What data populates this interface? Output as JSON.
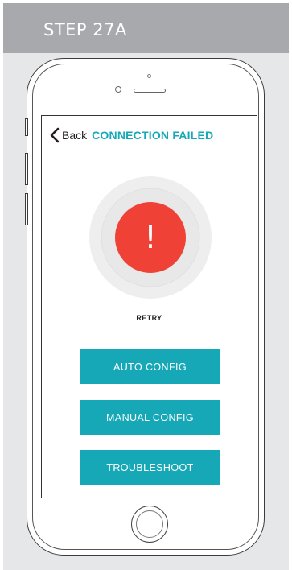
{
  "header": {
    "step_label": "STEP 27A"
  },
  "nav": {
    "back_label": "Back",
    "title": "CONNECTION FAILED"
  },
  "status": {
    "alert_symbol": "!",
    "retry_label": "RETRY"
  },
  "actions": {
    "auto_config": "AUTO CONFIG",
    "manual_config": "MANUAL CONFIG",
    "troubleshoot": "TROUBLESHOOT"
  },
  "colors": {
    "accent": "#17a8b8",
    "alert_red": "#ef4135",
    "header_gray": "#a7a9ac",
    "panel_gray": "#e6e7e8"
  },
  "icons": {
    "back": "chevron-left-icon",
    "alert": "exclamation-icon"
  }
}
